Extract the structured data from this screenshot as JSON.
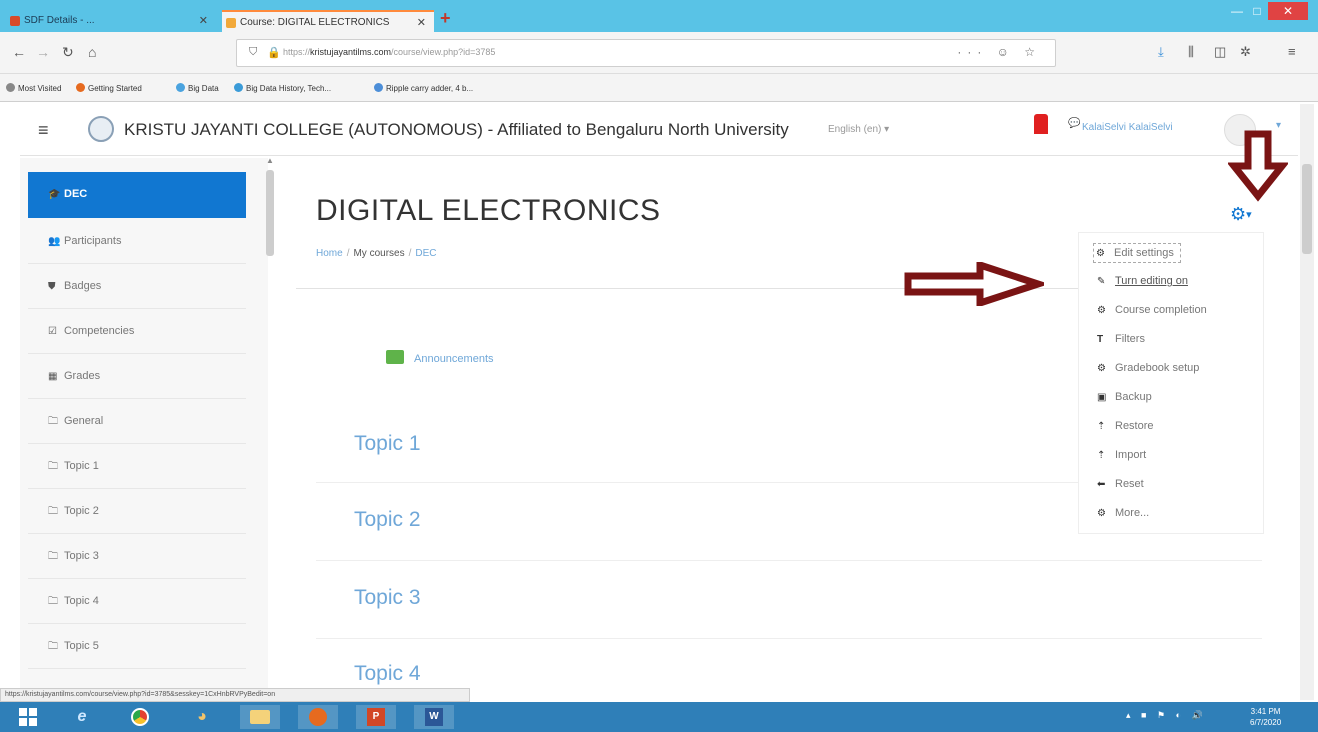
{
  "browser": {
    "tabs": [
      {
        "label": "SDF Details - ...",
        "close": "✕"
      },
      {
        "label": "Course: DIGITAL ELECTRONICS",
        "close": "✕"
      }
    ],
    "new_tab": "+",
    "url": "https://kristujayantilms.com/course/view.php?id=3785",
    "url_domain": "kristujayantilms.com",
    "url_prefix": "https://",
    "url_path": "/course/view.php?id=3785",
    "url_right_icons": "··· ☺ ☆",
    "bookmarks": [
      "Most Visited",
      "Getting Started",
      "Big Data",
      "Big Data History, Tech...",
      "Ripple carry adder, 4 b..."
    ],
    "status_url": "https://kristujayantilms.com/course/view.php?id=3785&sesskey=1CxHnbRVPyBedit=on"
  },
  "header": {
    "site_name": "KRISTU JAYANTI COLLEGE (AUTONOMOUS) - Affiliated to Bengaluru North University",
    "language": "English (en) ▾",
    "user_name": "KalaiSelvi KalaiSelvi",
    "user_caret": "▾"
  },
  "drawer": {
    "items": [
      {
        "label": "DEC",
        "icon": "graduation-cap-icon",
        "glyph": "🎓"
      },
      {
        "label": "Participants",
        "icon": "users-icon",
        "glyph": "👥"
      },
      {
        "label": "Badges",
        "icon": "shield-icon",
        "glyph": "⛊"
      },
      {
        "label": "Competencies",
        "icon": "checkbox-icon",
        "glyph": "☑"
      },
      {
        "label": "Grades",
        "icon": "table-icon",
        "glyph": "▦"
      },
      {
        "label": "General",
        "icon": "folder-icon",
        "glyph": "🗀"
      },
      {
        "label": "Topic 1",
        "icon": "folder-icon",
        "glyph": "🗀"
      },
      {
        "label": "Topic 2",
        "icon": "folder-icon",
        "glyph": "🗀"
      },
      {
        "label": "Topic 3",
        "icon": "folder-icon",
        "glyph": "🗀"
      },
      {
        "label": "Topic 4",
        "icon": "folder-icon",
        "glyph": "🗀"
      },
      {
        "label": "Topic 5",
        "icon": "folder-icon",
        "glyph": "🗀"
      }
    ]
  },
  "main": {
    "title": "DIGITAL ELECTRONICS",
    "breadcrumb": [
      "Home",
      "My courses",
      "DEC"
    ],
    "breadcrumb_sep": "/",
    "announcements": "Announcements",
    "topics": [
      "Topic 1",
      "Topic 2",
      "Topic 3",
      "Topic 4"
    ]
  },
  "settings_menu": {
    "gear_glyph": "⚙",
    "caret": "▾",
    "items": [
      {
        "label": "Edit settings",
        "icon": "gear-icon",
        "glyph": "⚙"
      },
      {
        "label": "Turn editing on",
        "icon": "pencil-icon",
        "glyph": "✎"
      },
      {
        "label": "Course completion",
        "icon": "gear-icon",
        "glyph": "⚙"
      },
      {
        "label": "Filters",
        "icon": "filter-icon",
        "glyph": "T"
      },
      {
        "label": "Gradebook setup",
        "icon": "gear-icon",
        "glyph": "⚙"
      },
      {
        "label": "Backup",
        "icon": "backup-icon",
        "glyph": "▣"
      },
      {
        "label": "Restore",
        "icon": "upload-icon",
        "glyph": "⇡"
      },
      {
        "label": "Import",
        "icon": "upload-icon",
        "glyph": "⇡"
      },
      {
        "label": "Reset",
        "icon": "arrow-left-icon",
        "glyph": "⬅"
      },
      {
        "label": "More...",
        "icon": "gear-icon",
        "glyph": "⚙"
      }
    ]
  },
  "taskbar": {
    "clock_time": "3:41 PM",
    "clock_date": "6/7/2020"
  },
  "colors": {
    "accent": "#1177d1",
    "link": "#6fa7d8",
    "annotation_arrow": "#7a1414",
    "taskbar": "#2f7fb8"
  }
}
